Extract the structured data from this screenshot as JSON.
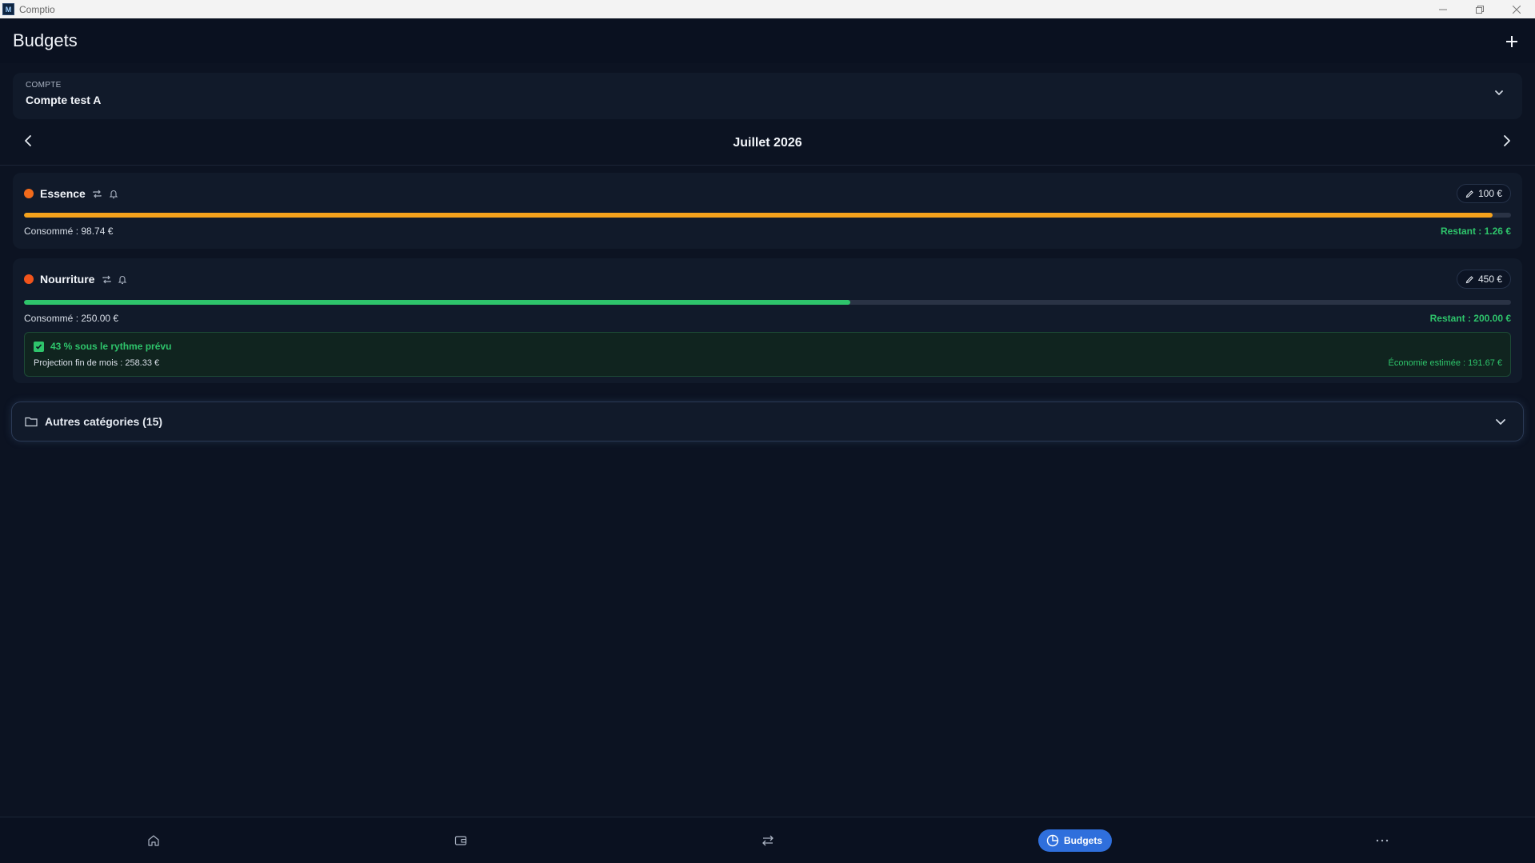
{
  "window": {
    "app_name": "Comptio",
    "logo_text": "M"
  },
  "header": {
    "title": "Budgets",
    "add_icon": "plus-icon"
  },
  "account": {
    "label": "COMPTE",
    "value": "Compte test A"
  },
  "period": {
    "label": "Juillet 2026"
  },
  "budgets": [
    {
      "name": "Essence",
      "dot_color": "#f26a1b",
      "bar_color": "#f5a21c",
      "amount": "100 €",
      "consumed": "Consommé : 98.74 €",
      "remaining": "Restant : 1.26 €",
      "progress": 0.9874
    },
    {
      "name": "Nourriture",
      "dot_color": "#f2541b",
      "bar_color": "#2ec46b",
      "amount": "450 €",
      "consumed": "Consommé : 250.00 €",
      "remaining": "Restant : 200.00 €",
      "progress": 0.5556,
      "projection": {
        "title": "43 % sous le rythme prévu",
        "subtitle": "Projection fin de mois : 258.33 €",
        "saving": "Économie estimée : 191.67 €"
      }
    }
  ],
  "other_categories": {
    "label": "Autres catégories (15)"
  },
  "bottom_nav": {
    "items": [
      {
        "icon": "home-icon"
      },
      {
        "icon": "wallet-icon"
      },
      {
        "icon": "transfer-icon"
      },
      {
        "icon": "pie-chart-icon",
        "label": "Budgets",
        "active": true
      },
      {
        "icon": "more-icon"
      }
    ]
  },
  "colors": {
    "background": "#0c1322",
    "card": "#111a2a",
    "accent": "#2f6fdc",
    "success": "#2ec46b"
  }
}
